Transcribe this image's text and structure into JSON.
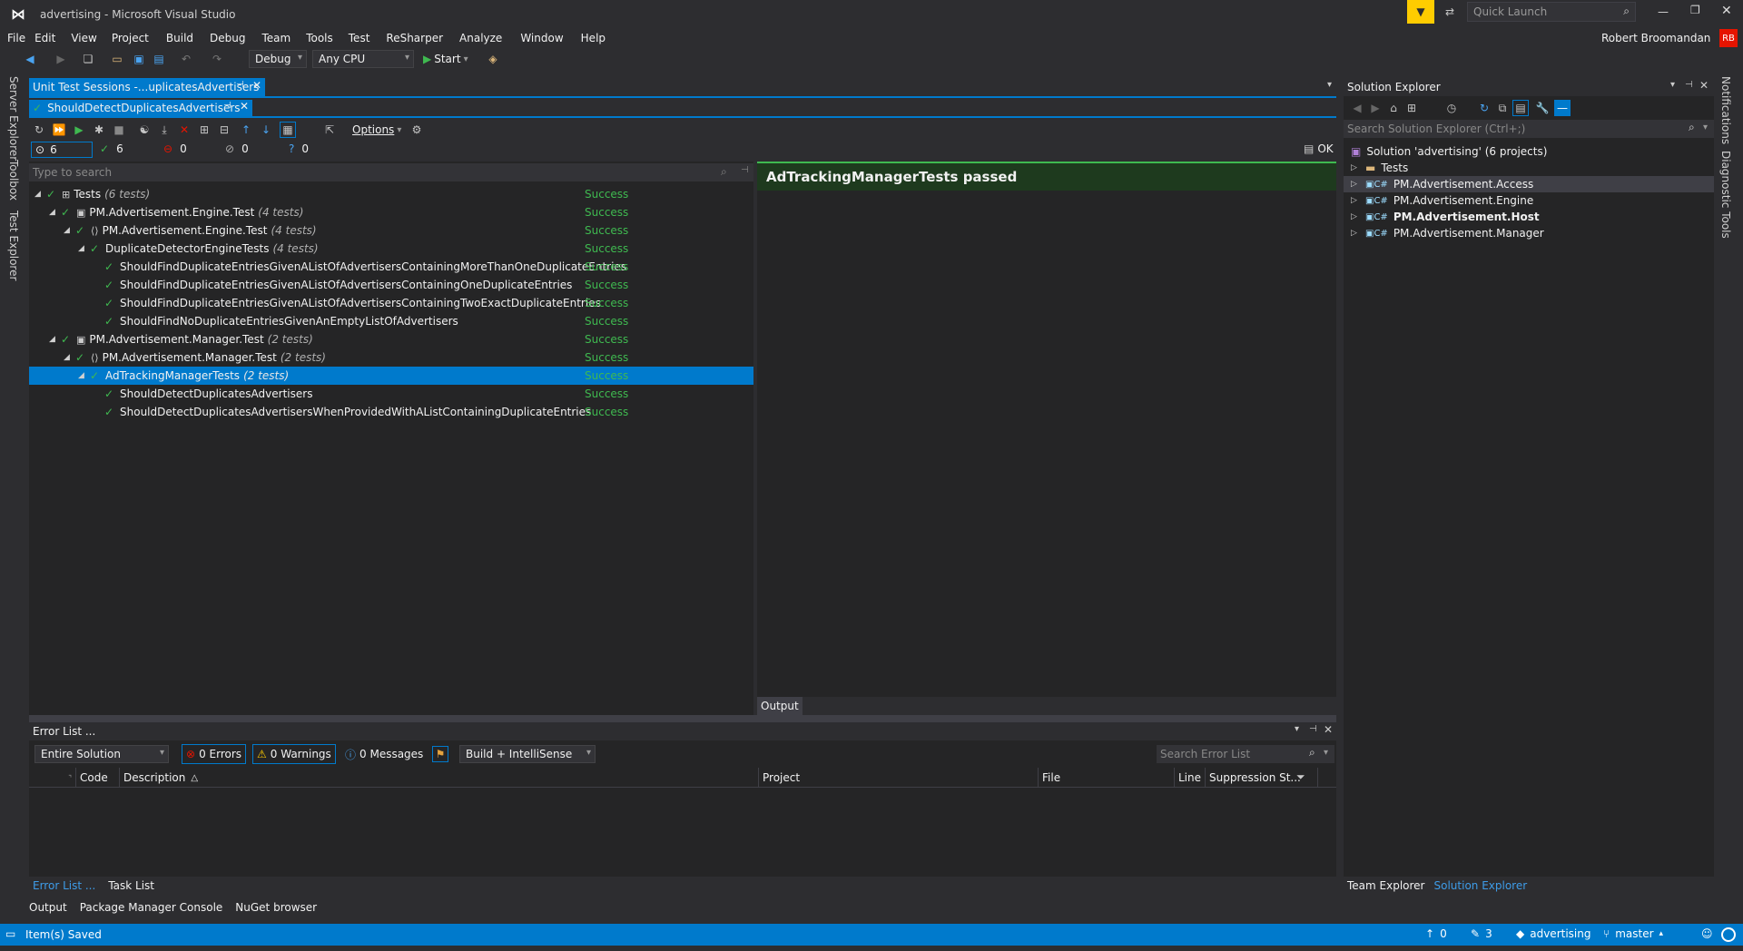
{
  "window": {
    "title": "advertising - Microsoft Visual Studio",
    "quick_launch_placeholder": "Quick Launch",
    "user": "Robert Broomandan",
    "user_initials": "RB"
  },
  "menu": [
    "File",
    "Edit",
    "View",
    "Project",
    "Build",
    "Debug",
    "Team",
    "Tools",
    "Test",
    "ReSharper",
    "Analyze",
    "Window",
    "Help"
  ],
  "toolbar": {
    "config": "Debug",
    "platform": "Any CPU",
    "start": "Start"
  },
  "left_tabs": [
    "Server Explorer",
    "Toolbox",
    "Test Explorer"
  ],
  "right_tabs": [
    "Notifications",
    "Diagnostic Tools"
  ],
  "doc_tabs": {
    "session": "Unit Test Sessions -...uplicatesAdvertisers",
    "test": "ShouldDetectDuplicatesAdvertisers"
  },
  "unit_test": {
    "options_label": "Options",
    "counts": {
      "total": "6",
      "passed": "6",
      "failed": "0",
      "ignored": "0",
      "unknown": "0"
    },
    "ok_label": "OK",
    "search_placeholder": "Type to search",
    "rows": [
      {
        "name": "Tests",
        "count": "(6 tests)",
        "status": "Success"
      },
      {
        "name": "PM.Advertisement.Engine.Test",
        "count": "(4 tests)",
        "status": "Success"
      },
      {
        "name": "PM.Advertisement.Engine.Test",
        "count": "(4 tests)",
        "status": "Success"
      },
      {
        "name": "DuplicateDetectorEngineTests",
        "count": "(4 tests)",
        "status": "Success"
      },
      {
        "name": "ShouldFindDuplicateEntriesGivenAListOfAdvertisersContainingMoreThanOneDuplicateEntries",
        "count": "",
        "status": "Success"
      },
      {
        "name": "ShouldFindDuplicateEntriesGivenAListOfAdvertisersContainingOneDuplicateEntries",
        "count": "",
        "status": "Success"
      },
      {
        "name": "ShouldFindDuplicateEntriesGivenAListOfAdvertisersContainingTwoExactDuplicateEntries",
        "count": "",
        "status": "Success"
      },
      {
        "name": "ShouldFindNoDuplicateEntriesGivenAnEmptyListOfAdvertisers",
        "count": "",
        "status": "Success"
      },
      {
        "name": "PM.Advertisement.Manager.Test",
        "count": "(2 tests)",
        "status": "Success"
      },
      {
        "name": "PM.Advertisement.Manager.Test",
        "count": "(2 tests)",
        "status": "Success"
      },
      {
        "name": "AdTrackingManagerTests",
        "count": "(2 tests)",
        "status": "Success"
      },
      {
        "name": "ShouldDetectDuplicatesAdvertisers",
        "count": "",
        "status": "Success"
      },
      {
        "name": "ShouldDetectDuplicatesAdvertisersWhenProvidedWithAListContainingDuplicateEntries",
        "count": "",
        "status": "Success"
      }
    ],
    "result_title": "AdTrackingManagerTests passed",
    "output_tab": "Output"
  },
  "solution_explorer": {
    "title": "Solution Explorer",
    "search_placeholder": "Search Solution Explorer (Ctrl+;)",
    "solution": "Solution 'advertising' (6 projects)",
    "items": [
      "Tests",
      "PM.Advertisement.Access",
      "PM.Advertisement.Engine",
      "PM.Advertisement.Host",
      "PM.Advertisement.Manager"
    ],
    "bottom_tabs": [
      "Team Explorer",
      "Solution Explorer"
    ]
  },
  "error_list": {
    "title": "Error List ...",
    "scope": "Entire Solution",
    "errors": "0 Errors",
    "warnings": "0 Warnings",
    "messages": "0 Messages",
    "build_filter": "Build + IntelliSense",
    "search_placeholder": "Search Error List",
    "columns": [
      "Code",
      "Description",
      "Project",
      "File",
      "Line",
      "Suppression St..."
    ],
    "bottom_tabs": [
      "Error List ...",
      "Task List"
    ]
  },
  "bottom_tool_tabs": [
    "Output",
    "Package Manager Console",
    "NuGet browser"
  ],
  "status_bar": {
    "message": "Item(s) Saved",
    "up": "0",
    "edits": "3",
    "repo": "advertising",
    "branch": "master"
  },
  "colors": {
    "accent": "#007acc",
    "success": "#3fb950",
    "error": "#e51400",
    "background": "#2d2d30",
    "panel": "#252526"
  }
}
